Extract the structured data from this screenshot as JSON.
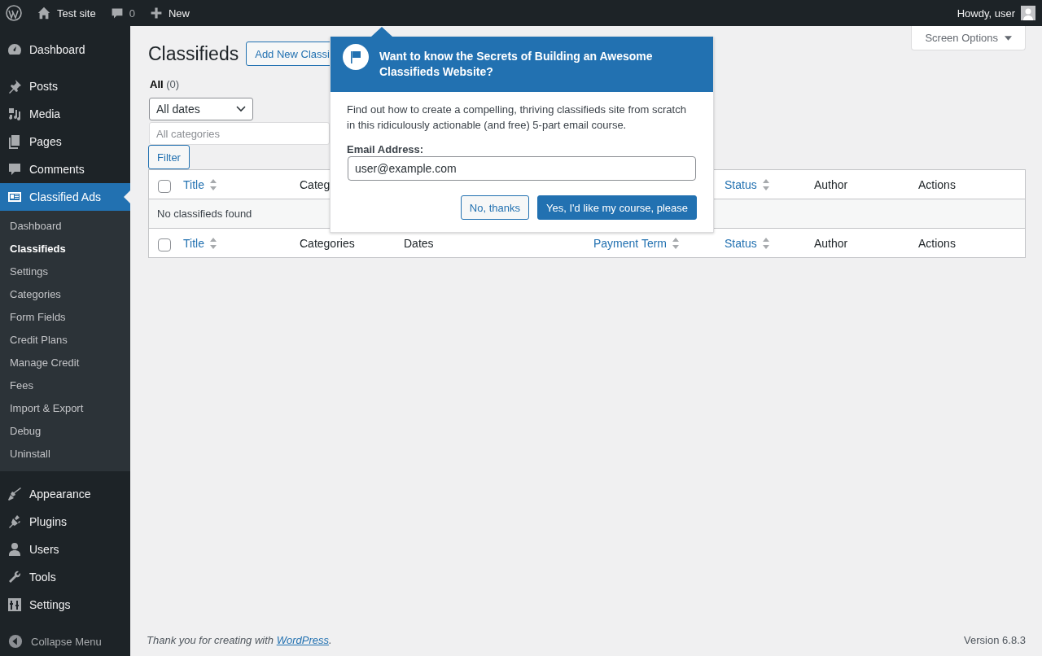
{
  "admin_bar": {
    "site": "Test site",
    "comments": "0",
    "new": "New",
    "greeting": "Howdy, user"
  },
  "sidebar": {
    "items": [
      {
        "label": "Dashboard",
        "selected": false
      },
      {
        "label": "Posts",
        "selected": false
      },
      {
        "label": "Media",
        "selected": false
      },
      {
        "label": "Pages",
        "selected": false
      },
      {
        "label": "Comments",
        "selected": false
      },
      {
        "label": "Classified Ads",
        "selected": true,
        "children": [
          {
            "label": "Dashboard",
            "selected": false
          },
          {
            "label": "Classifieds",
            "selected": true
          },
          {
            "label": "Settings",
            "selected": false
          },
          {
            "label": "Categories",
            "selected": false
          },
          {
            "label": "Form Fields",
            "selected": false
          },
          {
            "label": "Credit Plans",
            "selected": false
          },
          {
            "label": "Manage Credit",
            "selected": false
          },
          {
            "label": "Fees",
            "selected": false
          },
          {
            "label": "Import & Export",
            "selected": false
          },
          {
            "label": "Debug",
            "selected": false
          },
          {
            "label": "Uninstall",
            "selected": false
          }
        ]
      },
      {
        "label": "Appearance",
        "selected": false
      },
      {
        "label": "Plugins",
        "selected": false
      },
      {
        "label": "Users",
        "selected": false
      },
      {
        "label": "Tools",
        "selected": false
      },
      {
        "label": "Settings",
        "selected": false
      }
    ],
    "collapse": "Collapse Menu"
  },
  "screen_options": "Screen Options",
  "page": {
    "title": "Classifieds",
    "add_button": "Add New Classi",
    "filter_links": [
      {
        "label": "All",
        "count": "(0)",
        "selected": true
      }
    ],
    "dates_select": "All dates",
    "categories_placeholder": "All categories",
    "filter_button": "Filter"
  },
  "table": {
    "header_checkbox": {
      "checked": false
    },
    "footer_checkbox": {
      "checked": false
    },
    "header": [
      {
        "label": "Title",
        "sortable": true
      },
      {
        "label": "Categ",
        "sortable": false
      },
      {
        "label": "Status",
        "sortable": true
      },
      {
        "label": "Author",
        "sortable": false
      },
      {
        "label": "Actions",
        "sortable": false
      }
    ],
    "empty_message": "No classifieds found",
    "footer": [
      {
        "label": "Title",
        "sortable": true
      },
      {
        "label": "Categories",
        "sortable": false
      },
      {
        "label": "Dates",
        "sortable": false
      },
      {
        "label": "Payment Term",
        "sortable": true
      },
      {
        "label": "Status",
        "sortable": true
      },
      {
        "label": "Author",
        "sortable": false
      },
      {
        "label": "Actions",
        "sortable": false
      }
    ]
  },
  "popup": {
    "title": "Want to know the Secrets of Building an Awesome Classifieds Website?",
    "text": "Find out how to create a compelling, thriving classifieds site from scratch in this ridiculously actionable (and free) 5-part email course.",
    "email_label": "Email Address:",
    "email_value": "user@example.com",
    "decline": "No, thanks",
    "accept": "Yes, I'd like my course, please"
  },
  "footer": {
    "thanks": "Thank you for creating with",
    "link": "WordPress",
    "after_link": ".",
    "version": "Version 6.8.3"
  }
}
